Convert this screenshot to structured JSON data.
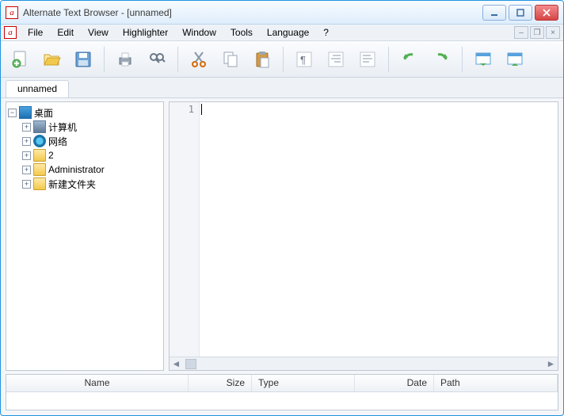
{
  "window": {
    "title": "Alternate Text Browser  - [unnamed]"
  },
  "menu": {
    "file": "File",
    "edit": "Edit",
    "view": "View",
    "highlighter": "Highlighter",
    "window": "Window",
    "tools": "Tools",
    "language": "Language",
    "help": "?"
  },
  "tabs": {
    "active": "unnamed"
  },
  "tree": {
    "root": "桌面",
    "computer": "计算机",
    "network": "网络",
    "two": "2",
    "admin": "Administrator",
    "newfolder": "新建文件夹"
  },
  "editor": {
    "line1": "1"
  },
  "columns": {
    "name": "Name",
    "size": "Size",
    "type": "Type",
    "date": "Date",
    "path": "Path"
  }
}
